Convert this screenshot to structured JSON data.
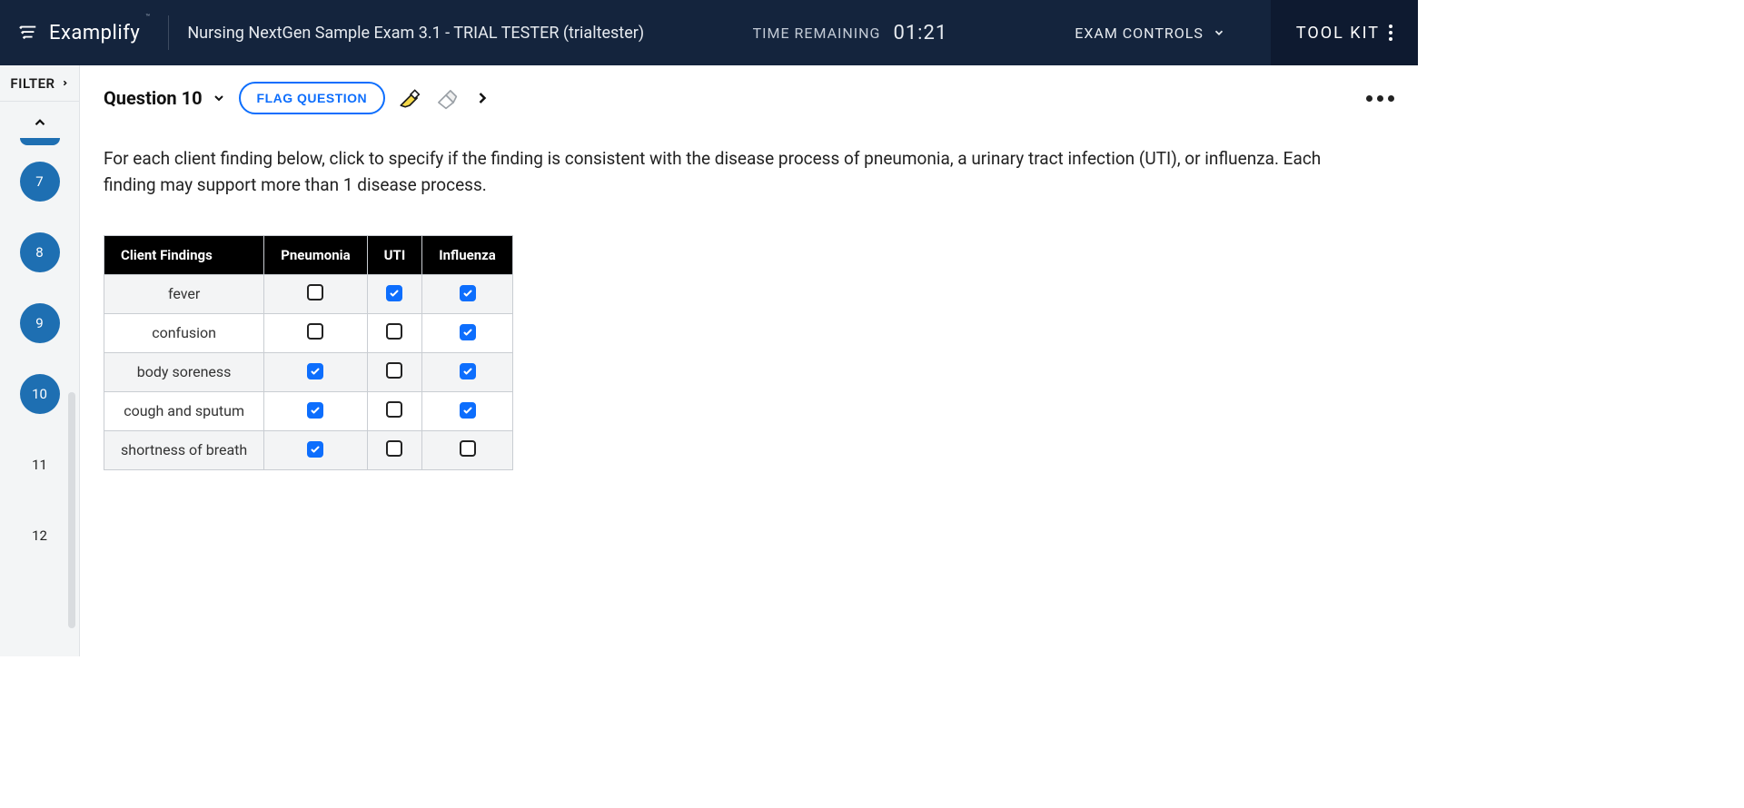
{
  "header": {
    "brand": "Examplify",
    "exam_title": "Nursing NextGen Sample Exam 3.1 - TRIAL TESTER (trialtester)",
    "time_label": "TIME REMAINING",
    "time_value": "01:21",
    "exam_controls": "EXAM CONTROLS",
    "toolkit": "TOOL KIT"
  },
  "sidebar": {
    "filter_label": "FILTER",
    "questions": [
      {
        "n": "7",
        "active": true
      },
      {
        "n": "8",
        "active": true
      },
      {
        "n": "9",
        "active": true
      },
      {
        "n": "10",
        "active": true
      },
      {
        "n": "11",
        "active": false
      },
      {
        "n": "12",
        "active": false
      }
    ]
  },
  "toolbar": {
    "question_label": "Question 10",
    "flag_label": "FLAG QUESTION"
  },
  "question": {
    "prompt": "For each client finding below, click to specify if the finding is consistent with the disease process of pneumonia, a urinary tract infection (UTI), or influenza. Each finding may support more than 1 disease process."
  },
  "matrix": {
    "headers": [
      "Client Findings",
      "Pneumonia",
      "UTI",
      "Influenza"
    ],
    "rows": [
      {
        "label": "fever",
        "cells": [
          false,
          true,
          true
        ]
      },
      {
        "label": "confusion",
        "cells": [
          false,
          false,
          true
        ]
      },
      {
        "label": "body soreness",
        "cells": [
          true,
          false,
          true
        ]
      },
      {
        "label": "cough and sputum",
        "cells": [
          true,
          false,
          true
        ]
      },
      {
        "label": "shortness of breath",
        "cells": [
          true,
          false,
          false
        ]
      }
    ]
  }
}
